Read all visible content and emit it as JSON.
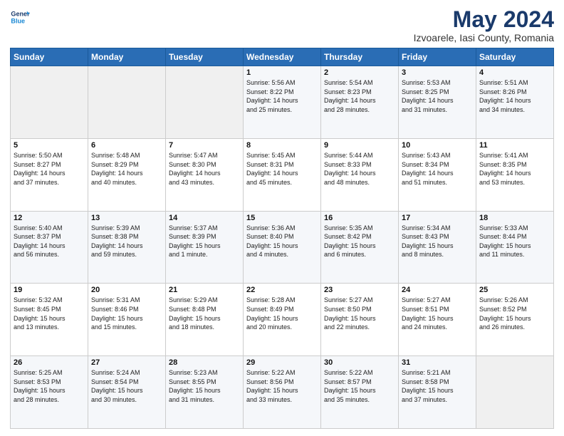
{
  "logo": {
    "line1": "General",
    "line2": "Blue"
  },
  "title": "May 2024",
  "subtitle": "Izvoarele, Iasi County, Romania",
  "weekdays": [
    "Sunday",
    "Monday",
    "Tuesday",
    "Wednesday",
    "Thursday",
    "Friday",
    "Saturday"
  ],
  "weeks": [
    [
      {
        "day": "",
        "info": ""
      },
      {
        "day": "",
        "info": ""
      },
      {
        "day": "",
        "info": ""
      },
      {
        "day": "1",
        "info": "Sunrise: 5:56 AM\nSunset: 8:22 PM\nDaylight: 14 hours\nand 25 minutes."
      },
      {
        "day": "2",
        "info": "Sunrise: 5:54 AM\nSunset: 8:23 PM\nDaylight: 14 hours\nand 28 minutes."
      },
      {
        "day": "3",
        "info": "Sunrise: 5:53 AM\nSunset: 8:25 PM\nDaylight: 14 hours\nand 31 minutes."
      },
      {
        "day": "4",
        "info": "Sunrise: 5:51 AM\nSunset: 8:26 PM\nDaylight: 14 hours\nand 34 minutes."
      }
    ],
    [
      {
        "day": "5",
        "info": "Sunrise: 5:50 AM\nSunset: 8:27 PM\nDaylight: 14 hours\nand 37 minutes."
      },
      {
        "day": "6",
        "info": "Sunrise: 5:48 AM\nSunset: 8:29 PM\nDaylight: 14 hours\nand 40 minutes."
      },
      {
        "day": "7",
        "info": "Sunrise: 5:47 AM\nSunset: 8:30 PM\nDaylight: 14 hours\nand 43 minutes."
      },
      {
        "day": "8",
        "info": "Sunrise: 5:45 AM\nSunset: 8:31 PM\nDaylight: 14 hours\nand 45 minutes."
      },
      {
        "day": "9",
        "info": "Sunrise: 5:44 AM\nSunset: 8:33 PM\nDaylight: 14 hours\nand 48 minutes."
      },
      {
        "day": "10",
        "info": "Sunrise: 5:43 AM\nSunset: 8:34 PM\nDaylight: 14 hours\nand 51 minutes."
      },
      {
        "day": "11",
        "info": "Sunrise: 5:41 AM\nSunset: 8:35 PM\nDaylight: 14 hours\nand 53 minutes."
      }
    ],
    [
      {
        "day": "12",
        "info": "Sunrise: 5:40 AM\nSunset: 8:37 PM\nDaylight: 14 hours\nand 56 minutes."
      },
      {
        "day": "13",
        "info": "Sunrise: 5:39 AM\nSunset: 8:38 PM\nDaylight: 14 hours\nand 59 minutes."
      },
      {
        "day": "14",
        "info": "Sunrise: 5:37 AM\nSunset: 8:39 PM\nDaylight: 15 hours\nand 1 minute."
      },
      {
        "day": "15",
        "info": "Sunrise: 5:36 AM\nSunset: 8:40 PM\nDaylight: 15 hours\nand 4 minutes."
      },
      {
        "day": "16",
        "info": "Sunrise: 5:35 AM\nSunset: 8:42 PM\nDaylight: 15 hours\nand 6 minutes."
      },
      {
        "day": "17",
        "info": "Sunrise: 5:34 AM\nSunset: 8:43 PM\nDaylight: 15 hours\nand 8 minutes."
      },
      {
        "day": "18",
        "info": "Sunrise: 5:33 AM\nSunset: 8:44 PM\nDaylight: 15 hours\nand 11 minutes."
      }
    ],
    [
      {
        "day": "19",
        "info": "Sunrise: 5:32 AM\nSunset: 8:45 PM\nDaylight: 15 hours\nand 13 minutes."
      },
      {
        "day": "20",
        "info": "Sunrise: 5:31 AM\nSunset: 8:46 PM\nDaylight: 15 hours\nand 15 minutes."
      },
      {
        "day": "21",
        "info": "Sunrise: 5:29 AM\nSunset: 8:48 PM\nDaylight: 15 hours\nand 18 minutes."
      },
      {
        "day": "22",
        "info": "Sunrise: 5:28 AM\nSunset: 8:49 PM\nDaylight: 15 hours\nand 20 minutes."
      },
      {
        "day": "23",
        "info": "Sunrise: 5:27 AM\nSunset: 8:50 PM\nDaylight: 15 hours\nand 22 minutes."
      },
      {
        "day": "24",
        "info": "Sunrise: 5:27 AM\nSunset: 8:51 PM\nDaylight: 15 hours\nand 24 minutes."
      },
      {
        "day": "25",
        "info": "Sunrise: 5:26 AM\nSunset: 8:52 PM\nDaylight: 15 hours\nand 26 minutes."
      }
    ],
    [
      {
        "day": "26",
        "info": "Sunrise: 5:25 AM\nSunset: 8:53 PM\nDaylight: 15 hours\nand 28 minutes."
      },
      {
        "day": "27",
        "info": "Sunrise: 5:24 AM\nSunset: 8:54 PM\nDaylight: 15 hours\nand 30 minutes."
      },
      {
        "day": "28",
        "info": "Sunrise: 5:23 AM\nSunset: 8:55 PM\nDaylight: 15 hours\nand 31 minutes."
      },
      {
        "day": "29",
        "info": "Sunrise: 5:22 AM\nSunset: 8:56 PM\nDaylight: 15 hours\nand 33 minutes."
      },
      {
        "day": "30",
        "info": "Sunrise: 5:22 AM\nSunset: 8:57 PM\nDaylight: 15 hours\nand 35 minutes."
      },
      {
        "day": "31",
        "info": "Sunrise: 5:21 AM\nSunset: 8:58 PM\nDaylight: 15 hours\nand 37 minutes."
      },
      {
        "day": "",
        "info": ""
      }
    ]
  ]
}
